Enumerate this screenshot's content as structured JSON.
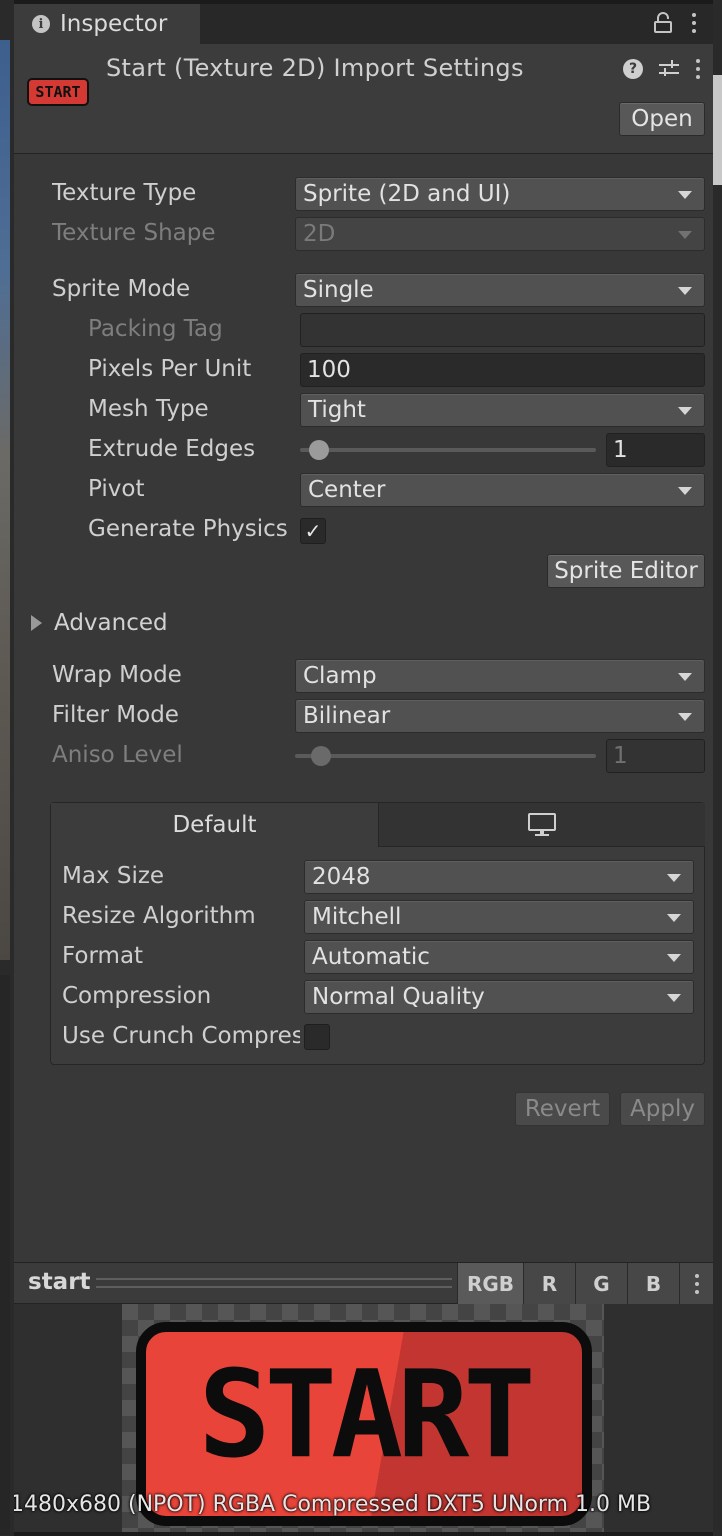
{
  "tab": {
    "label": "Inspector"
  },
  "header": {
    "title": "Start (Texture 2D) Import Settings",
    "thumbnail_text": "START",
    "open_label": "Open"
  },
  "fields": {
    "texture_type": {
      "label": "Texture Type",
      "value": "Sprite (2D and UI)"
    },
    "texture_shape": {
      "label": "Texture Shape",
      "value": "2D"
    },
    "sprite_mode": {
      "label": "Sprite Mode",
      "value": "Single"
    },
    "packing_tag": {
      "label": "Packing Tag",
      "value": ""
    },
    "pixels_per_unit": {
      "label": "Pixels Per Unit",
      "value": "100"
    },
    "mesh_type": {
      "label": "Mesh Type",
      "value": "Tight"
    },
    "extrude_edges": {
      "label": "Extrude Edges",
      "value": "1",
      "slider_fraction": 0.06
    },
    "pivot": {
      "label": "Pivot",
      "value": "Center"
    },
    "generate_physics": {
      "label": "Generate Physics Shape",
      "checked": true
    },
    "sprite_editor_label": "Sprite Editor",
    "advanced_label": "Advanced",
    "wrap_mode": {
      "label": "Wrap Mode",
      "value": "Clamp"
    },
    "filter_mode": {
      "label": "Filter Mode",
      "value": "Bilinear"
    },
    "aniso_level": {
      "label": "Aniso Level",
      "value": "1",
      "slider_fraction": 0.06
    }
  },
  "platform": {
    "default_tab": "Default",
    "pc_tab_icon": "monitor-icon",
    "max_size": {
      "label": "Max Size",
      "value": "2048"
    },
    "resize_algorithm": {
      "label": "Resize Algorithm",
      "value": "Mitchell"
    },
    "format": {
      "label": "Format",
      "value": "Automatic"
    },
    "compression": {
      "label": "Compression",
      "value": "Normal Quality"
    },
    "use_crunch": {
      "label": "Use Crunch Compression",
      "checked": false
    }
  },
  "actions": {
    "revert": "Revert",
    "apply": "Apply"
  },
  "preview": {
    "name": "start",
    "channels": [
      "RGB",
      "R",
      "G",
      "B"
    ],
    "image_text": "START",
    "info": "1480x680 (NPOT)  RGBA Compressed DXT5 UNorm   1.0 MB"
  },
  "colors": {
    "panel": "#383838",
    "button_red": "#e8443a",
    "accent": "#585858"
  }
}
